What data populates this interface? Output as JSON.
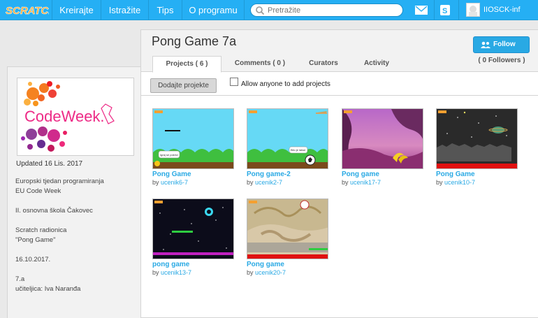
{
  "nav": {
    "logo_text": "SCRATCH",
    "items": [
      "Kreirajte",
      "Istražite",
      "Tips",
      "O programu"
    ],
    "search_placeholder": "Pretražite",
    "username": "IIOSCK-inf"
  },
  "left": {
    "logo_text": "CodeWeek.",
    "updated": "Updated 16 Lis. 2017",
    "description": [
      "Europski tjedan programiranja",
      "EU Code Week",
      "",
      "II. osnovna škola Čakovec",
      "",
      "Scratch radionica",
      "\"Pong Game\"",
      "",
      "16.10.2017.",
      "",
      "7.a",
      "učiteljica: Iva Naranđa"
    ]
  },
  "studio": {
    "title": "Pong Game 7a",
    "follow_label": "Follow",
    "followers": "( 0 Followers )",
    "tabs": [
      "Projects ( 6 )",
      "Comments ( 0 )",
      "Curators",
      "Activity"
    ],
    "add_button": "Dodajte projekte",
    "allow_label": "Allow anyone to add projects",
    "by_label": "by",
    "projects": [
      {
        "title": "Pong Game",
        "user": "ucenik6-7",
        "thumb_label": "Igraj se pokrici"
      },
      {
        "title": "Pong game-2",
        "user": "ucenik2-7",
        "thumb_label": "Bilo je lakse"
      },
      {
        "title": "Pong game",
        "user": "ucenik17-7",
        "thumb_label": ""
      },
      {
        "title": "Pong Game",
        "user": "ucenik10-7",
        "thumb_label": ""
      },
      {
        "title": "pong game",
        "user": "ucenik13-7",
        "thumb_label": ""
      },
      {
        "title": "Pong game",
        "user": "ucenik20-7",
        "thumb_label": ""
      }
    ]
  },
  "colors": {
    "nav_blue": "#25aff4",
    "link_blue": "#29a9e4"
  }
}
